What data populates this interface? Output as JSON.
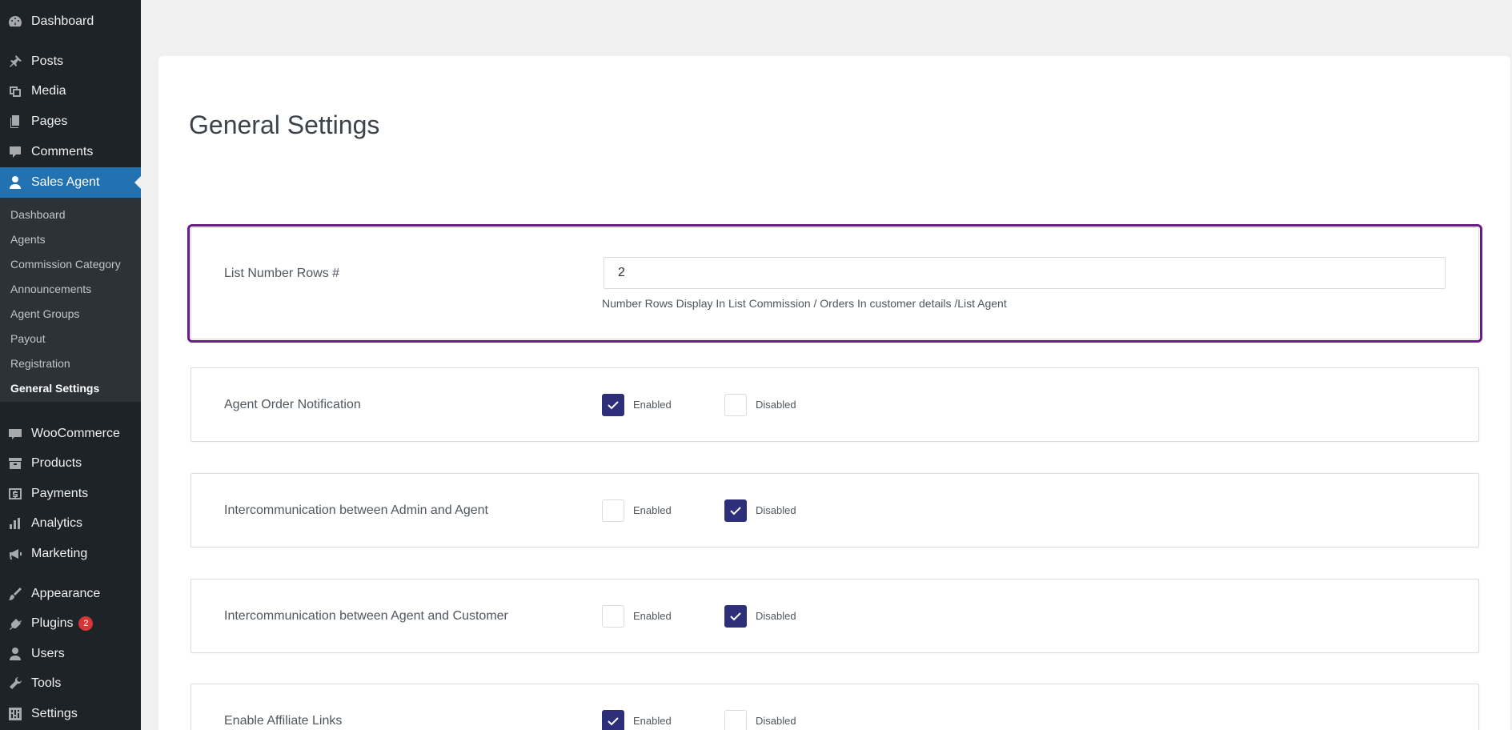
{
  "sidebar": {
    "items": [
      {
        "label": "Dashboard",
        "icon": "dashboard-icon"
      },
      {
        "label": "Posts",
        "icon": "pin-icon"
      },
      {
        "label": "Media",
        "icon": "media-icon"
      },
      {
        "label": "Pages",
        "icon": "pages-icon"
      },
      {
        "label": "Comments",
        "icon": "comment-icon"
      },
      {
        "label": "Sales Agent",
        "icon": "user-icon",
        "active": true
      },
      {
        "label": "WooCommerce",
        "icon": "woo-icon"
      },
      {
        "label": "Products",
        "icon": "archive-icon"
      },
      {
        "label": "Payments",
        "icon": "dollar-icon"
      },
      {
        "label": "Analytics",
        "icon": "bar-chart-icon"
      },
      {
        "label": "Marketing",
        "icon": "megaphone-icon"
      },
      {
        "label": "Appearance",
        "icon": "brush-icon"
      },
      {
        "label": "Plugins",
        "icon": "plug-icon",
        "badge": "2"
      },
      {
        "label": "Users",
        "icon": "users-icon"
      },
      {
        "label": "Tools",
        "icon": "wrench-icon"
      },
      {
        "label": "Settings",
        "icon": "settings-icon"
      }
    ],
    "submenu": [
      "Dashboard",
      "Agents",
      "Commission Category",
      "Announcements",
      "Agent Groups",
      "Payout",
      "Registration",
      "General Settings"
    ]
  },
  "main": {
    "title": "General Settings",
    "list_rows": {
      "label": "List Number Rows #",
      "value": "2",
      "hint": "Number Rows Display In List Commission / Orders In customer details /List Agent"
    },
    "options": {
      "enabled": "Enabled",
      "disabled": "Disabled"
    },
    "settings": [
      {
        "label": "Agent Order Notification",
        "enabled": true
      },
      {
        "label": "Intercommunication between Admin and Agent",
        "enabled": false
      },
      {
        "label": "Intercommunication between Agent and Customer",
        "enabled": false
      },
      {
        "label": "Enable Affiliate Links",
        "enabled": true
      }
    ]
  },
  "colors": {
    "sidebar_bg": "#1d2327",
    "active_menu": "#2271b1",
    "checkbox_checked": "#2e2f7a",
    "highlight_border": "#6a1b8a",
    "badge": "#d63638"
  }
}
